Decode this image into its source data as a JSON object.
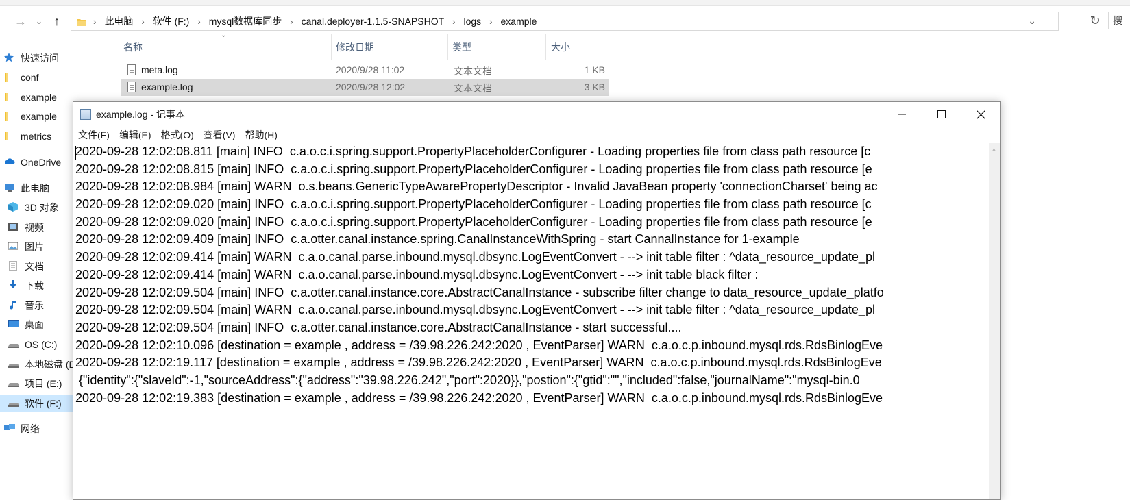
{
  "explorer": {
    "breadcrumb": [
      "此电脑",
      "软件 (F:)",
      "mysql数据库同步",
      "canal.deployer-1.1.5-SNAPSHOT",
      "logs",
      "example"
    ],
    "search_label": "搜",
    "sidebar": [
      {
        "label": "快速访问",
        "icon": "star-icon"
      },
      {
        "label": "conf",
        "icon": "folder-icon"
      },
      {
        "label": "example",
        "icon": "folder-icon"
      },
      {
        "label": "example",
        "icon": "folder-icon"
      },
      {
        "label": "metrics",
        "icon": "folder-icon"
      },
      {
        "label": "OneDrive",
        "icon": "cloud-icon"
      },
      {
        "label": "此电脑",
        "icon": "computer-icon"
      },
      {
        "label": "3D 对象",
        "icon": "cube-icon"
      },
      {
        "label": "视频",
        "icon": "video-icon"
      },
      {
        "label": "图片",
        "icon": "picture-icon"
      },
      {
        "label": "文档",
        "icon": "document-icon"
      },
      {
        "label": "下载",
        "icon": "download-icon"
      },
      {
        "label": "音乐",
        "icon": "music-icon"
      },
      {
        "label": "桌面",
        "icon": "desktop-icon"
      },
      {
        "label": "OS (C:)",
        "icon": "drive-icon"
      },
      {
        "label": "本地磁盘 (D",
        "icon": "drive-icon"
      },
      {
        "label": "项目 (E:)",
        "icon": "drive-icon"
      },
      {
        "label": "软件 (F:)",
        "icon": "drive-icon"
      },
      {
        "label": "网络",
        "icon": "network-icon"
      }
    ],
    "columns": {
      "name": "名称",
      "modified": "修改日期",
      "type": "类型",
      "size": "大小"
    },
    "files": [
      {
        "name": "meta.log",
        "modified": "2020/9/28 11:02",
        "type": "文本文档",
        "size": "1 KB"
      },
      {
        "name": "example.log",
        "modified": "2020/9/28 12:02",
        "type": "文本文档",
        "size": "3 KB"
      }
    ]
  },
  "notepad": {
    "title": "example.log - 记事本",
    "menu": [
      "文件(F)",
      "编辑(E)",
      "格式(O)",
      "查看(V)",
      "帮助(H)"
    ],
    "lines": [
      "2020-09-28 12:02:08.811 [main] INFO  c.a.o.c.i.spring.support.PropertyPlaceholderConfigurer - Loading properties file from class path resource [c",
      "2020-09-28 12:02:08.815 [main] INFO  c.a.o.c.i.spring.support.PropertyPlaceholderConfigurer - Loading properties file from class path resource [e",
      "2020-09-28 12:02:08.984 [main] WARN  o.s.beans.GenericTypeAwarePropertyDescriptor - Invalid JavaBean property 'connectionCharset' being ac",
      "2020-09-28 12:02:09.020 [main] INFO  c.a.o.c.i.spring.support.PropertyPlaceholderConfigurer - Loading properties file from class path resource [c",
      "2020-09-28 12:02:09.020 [main] INFO  c.a.o.c.i.spring.support.PropertyPlaceholderConfigurer - Loading properties file from class path resource [e",
      "2020-09-28 12:02:09.409 [main] INFO  c.a.otter.canal.instance.spring.CanalInstanceWithSpring - start CannalInstance for 1-example",
      "2020-09-28 12:02:09.414 [main] WARN  c.a.o.canal.parse.inbound.mysql.dbsync.LogEventConvert - --> init table filter : ^data_resource_update_pl",
      "2020-09-28 12:02:09.414 [main] WARN  c.a.o.canal.parse.inbound.mysql.dbsync.LogEventConvert - --> init table black filter :",
      "2020-09-28 12:02:09.504 [main] INFO  c.a.otter.canal.instance.core.AbstractCanalInstance - subscribe filter change to data_resource_update_platfo",
      "2020-09-28 12:02:09.504 [main] WARN  c.a.o.canal.parse.inbound.mysql.dbsync.LogEventConvert - --> init table filter : ^data_resource_update_pl",
      "2020-09-28 12:02:09.504 [main] INFO  c.a.otter.canal.instance.core.AbstractCanalInstance - start successful....",
      "2020-09-28 12:02:10.096 [destination = example , address = /39.98.226.242:2020 , EventParser] WARN  c.a.o.c.p.inbound.mysql.rds.RdsBinlogEve",
      "2020-09-28 12:02:19.117 [destination = example , address = /39.98.226.242:2020 , EventParser] WARN  c.a.o.c.p.inbound.mysql.rds.RdsBinlogEve",
      " {\"identity\":{\"slaveId\":-1,\"sourceAddress\":{\"address\":\"39.98.226.242\",\"port\":2020}},\"postion\":{\"gtid\":\"\",\"included\":false,\"journalName\":\"mysql-bin.0",
      "2020-09-28 12:02:19.383 [destination = example , address = /39.98.226.242:2020 , EventParser] WARN  c.a.o.c.p.inbound.mysql.rds.RdsBinlogEve"
    ]
  }
}
